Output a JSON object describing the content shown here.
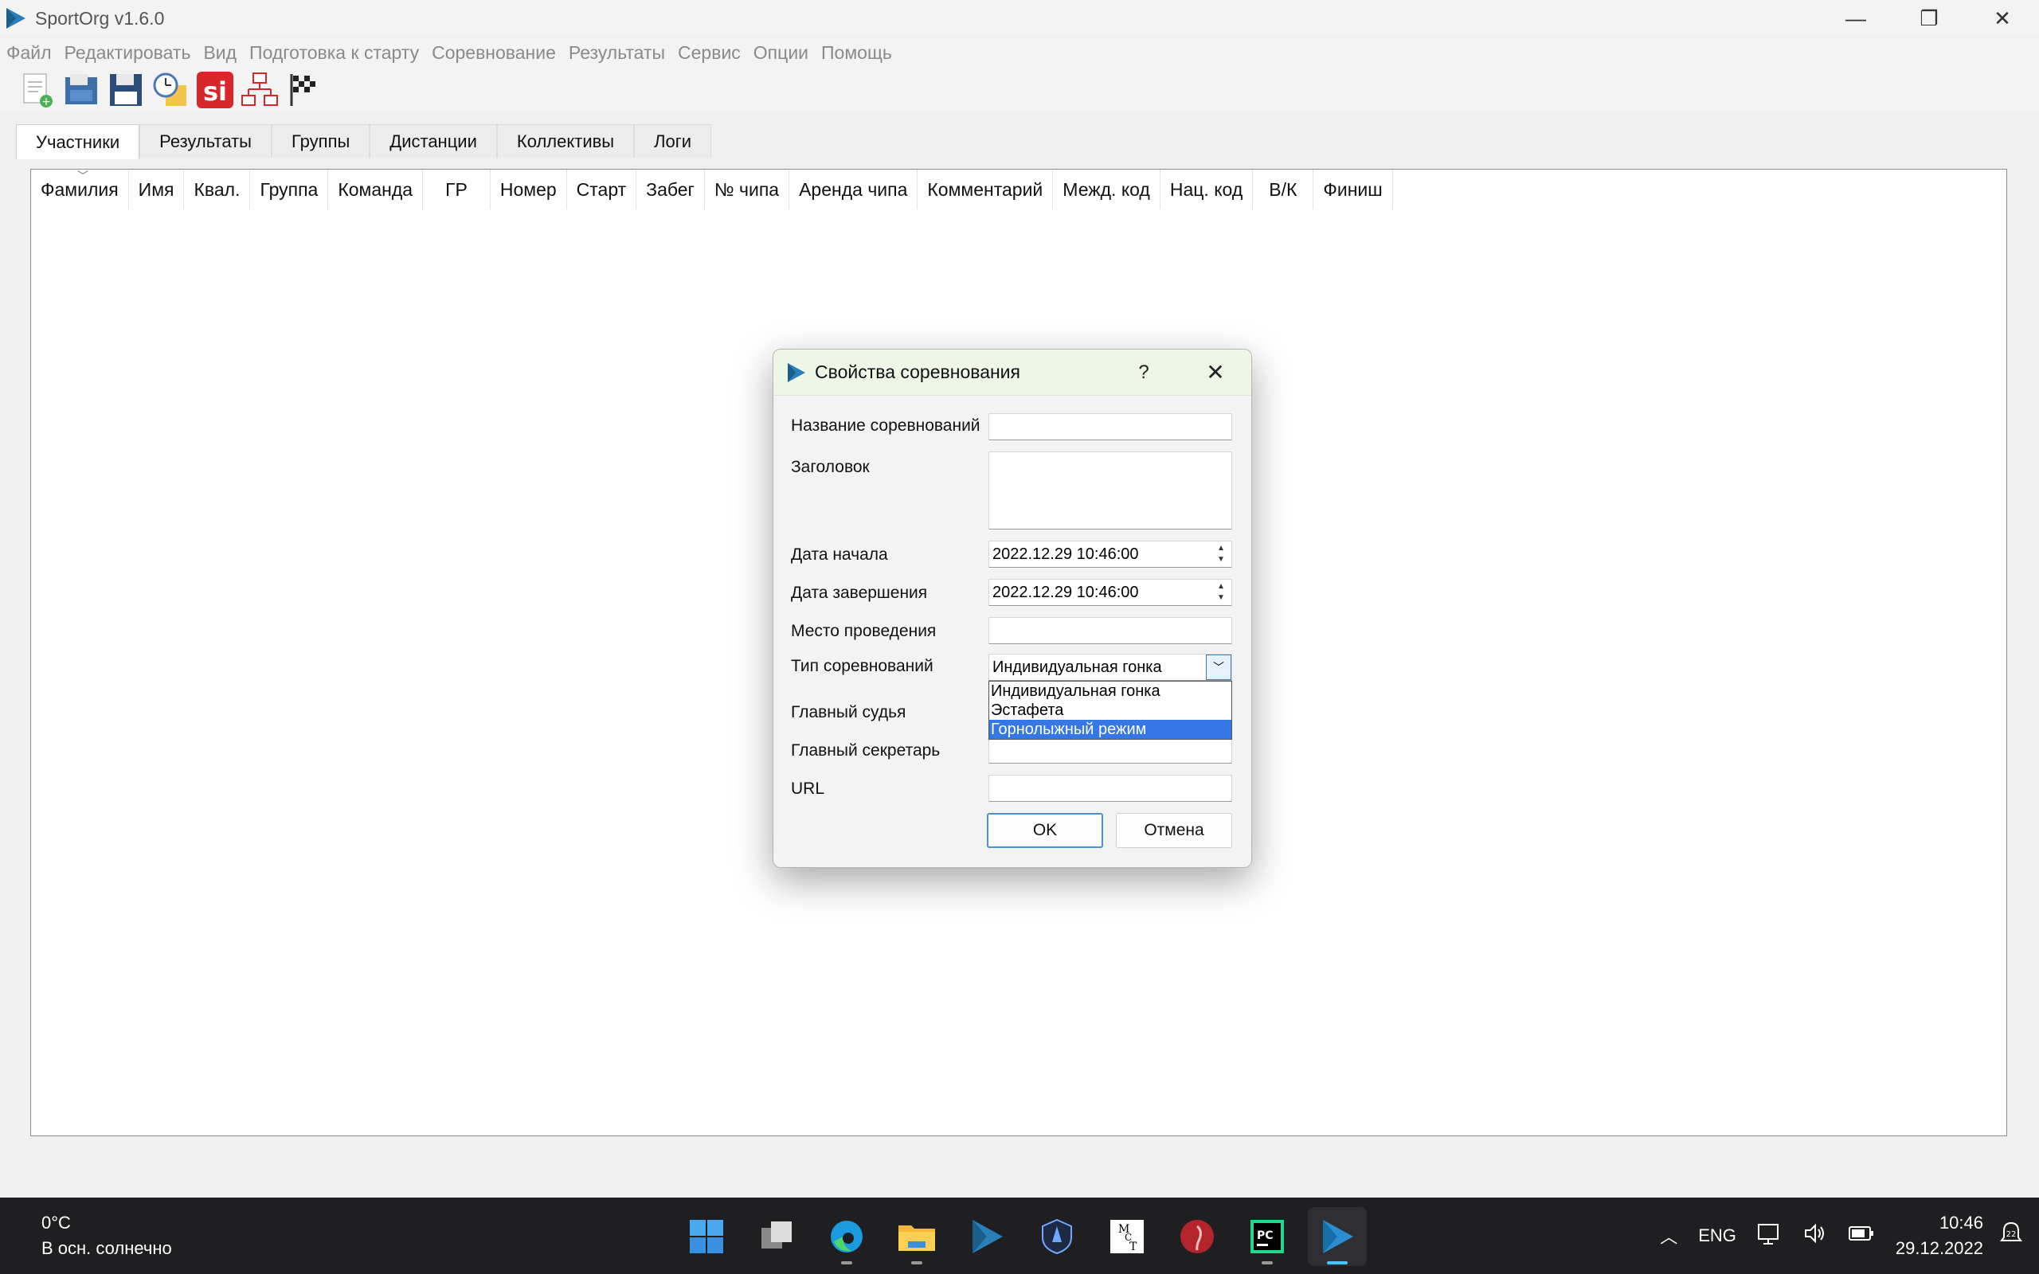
{
  "window": {
    "title": "SportOrg v1.6.0",
    "minimize": "—",
    "restore": "❐",
    "close": "✕"
  },
  "menu": [
    "Файл",
    "Редактировать",
    "Вид",
    "Подготовка к старту",
    "Соревнование",
    "Результаты",
    "Сервис",
    "Опции",
    "Помощь"
  ],
  "toolbar_icons": [
    "new-file-icon",
    "open-file-icon",
    "save-icon",
    "clock-icon",
    "sportident-icon",
    "network-icon",
    "finish-flag-icon"
  ],
  "tabs": [
    "Участники",
    "Результаты",
    "Группы",
    "Дистанции",
    "Коллективы",
    "Логи"
  ],
  "active_tab": "Участники",
  "columns": [
    "Фамилия",
    "Имя",
    "Квал.",
    "Группа",
    "Команда",
    "ГР",
    "Номер",
    "Старт",
    "Забег",
    "№ чипа",
    "Аренда чипа",
    "Комментарий",
    "Межд. код",
    "Нац. код",
    "В/К",
    "Финиш"
  ],
  "dialog": {
    "title": "Свойства соревнования",
    "help": "?",
    "close": "✕",
    "fields": {
      "name_label": "Название соревнований",
      "name_value": "",
      "header_label": "Заголовок",
      "header_value": "",
      "start_label": "Дата начала",
      "start_value": "2022.12.29 10:46:00",
      "end_label": "Дата завершения",
      "end_value": "2022.12.29 10:46:00",
      "place_label": "Место проведения",
      "place_value": "",
      "type_label": "Тип соревнований",
      "type_value": "Индивидуальная гонка",
      "judge_label": "Главный судья",
      "secretary_label": "Главный секретарь",
      "url_label": "URL",
      "url_value": ""
    },
    "type_options": [
      "Индивидуальная гонка",
      "Эстафета",
      "Горнолыжный режим"
    ],
    "type_highlighted": "Горнолыжный режим",
    "ok": "OK",
    "cancel": "Отмена"
  },
  "taskbar": {
    "temperature": "0°C",
    "weather": "В осн. солнечно",
    "apps": [
      "windows-start-icon",
      "task-view-icon",
      "edge-icon",
      "file-explorer-icon",
      "sportorg-icon",
      "shield-app-icon",
      "mct-app-icon",
      "anatomy-app-icon",
      "pycharm-icon",
      "sportorg-active-icon"
    ],
    "language": "ENG",
    "time": "10:46",
    "date": "29.12.2022",
    "notification_count": "22"
  },
  "colors": {
    "accent": "#3578e5",
    "dialog_title_bg": "#eef6e6",
    "taskbar_bg": "#1f1f22"
  }
}
